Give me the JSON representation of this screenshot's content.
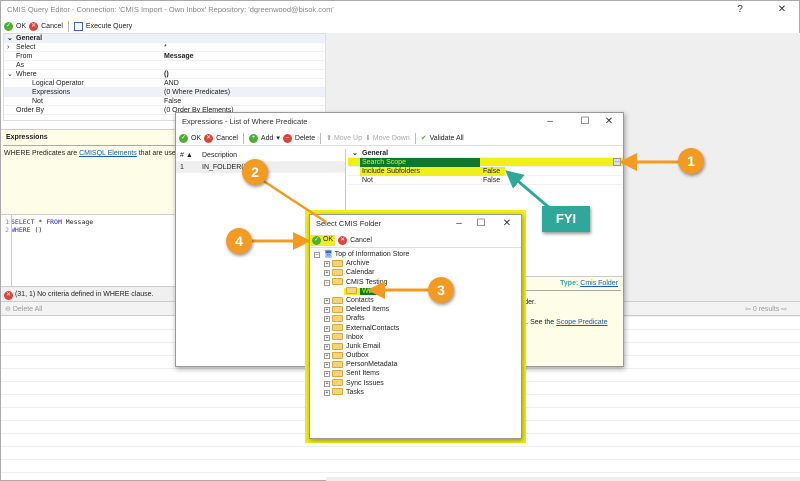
{
  "main": {
    "title": "CMIS Query Editor - Connection: 'CMIS Import - Own Inbox' Repository: 'dgreenwood@bisok.com'",
    "help_btn": "?",
    "toolbar": {
      "ok": "OK",
      "cancel": "Cancel",
      "execute": "Execute Query"
    },
    "grid": {
      "section": "General",
      "rows": [
        {
          "k": "Select",
          "v": "*"
        },
        {
          "k": "From",
          "v": "Message"
        },
        {
          "k": "As",
          "v": ""
        },
        {
          "k": "Where",
          "v": "()"
        },
        {
          "k": "Logical Operator",
          "v": "AND"
        },
        {
          "k": "Expressions",
          "v": "(0 Where Predicates)"
        },
        {
          "k": "Not",
          "v": "False"
        },
        {
          "k": "Order By",
          "v": "(0 Order By Elements)"
        }
      ]
    },
    "help": {
      "title": "Expressions",
      "text_pre": "WHERE Predicates are ",
      "link": "CMISQL Elements",
      "text_post": " that are use"
    },
    "code": {
      "lines": [
        {
          "n": "1",
          "kw1": "SELECT",
          "mid": " * ",
          "kw2": "FROM",
          "rest": " Message"
        },
        {
          "n": "2",
          "kw1": "WHERE",
          "mid": " ()",
          "kw2": "",
          "rest": ""
        }
      ]
    },
    "error": "(31, 1) No criteria defined in WHERE clause.",
    "delete_all": "Delete All",
    "results": "0 results"
  },
  "expr": {
    "title": "Expressions - List of Where Predicate",
    "toolbar": {
      "ok": "OK",
      "cancel": "Cancel",
      "add": "Add",
      "delete": "Delete",
      "move_up": "Move Up",
      "move_down": "Move Down",
      "validate": "Validate All"
    },
    "list": {
      "col_num": "# ▲",
      "col_desc": "Description",
      "rows": [
        {
          "n": "1",
          "d": "IN_FOLDER('')"
        }
      ]
    },
    "props": {
      "section": "General",
      "rows": [
        {
          "k": "Search Scope",
          "v": ""
        },
        {
          "k": "Include Subfolders",
          "v": "False"
        },
        {
          "k": "Not",
          "v": "False"
        }
      ]
    },
    "help": {
      "type_label": "Type:",
      "type_link": "Cmis Folder",
      "line1": "d folder.",
      "line2": "ched. See the ",
      "link2": "Scope Predicate"
    }
  },
  "folder": {
    "title": "Select CMIS Folder",
    "ok": "OK",
    "cancel": "Cancel",
    "root": "Top of Information Store",
    "items": [
      "Archive",
      "Calendar",
      "CMIS Testing",
      "Wiki",
      "Contacts",
      "Deleted Items",
      "Drafts",
      "ExternalContacts",
      "Inbox",
      "Junk Email",
      "Outbox",
      "PersonMetadata",
      "Sent Items",
      "Sync Issues",
      "Tasks"
    ]
  },
  "callouts": {
    "c1": "1",
    "c2": "2",
    "c3": "3",
    "c4": "4",
    "fyi": "FYI"
  },
  "colors": {
    "highlight": "#f0ef1a",
    "selected": "#0d7a2a",
    "callout": "#f39a22",
    "fyi": "#2fa89a"
  }
}
